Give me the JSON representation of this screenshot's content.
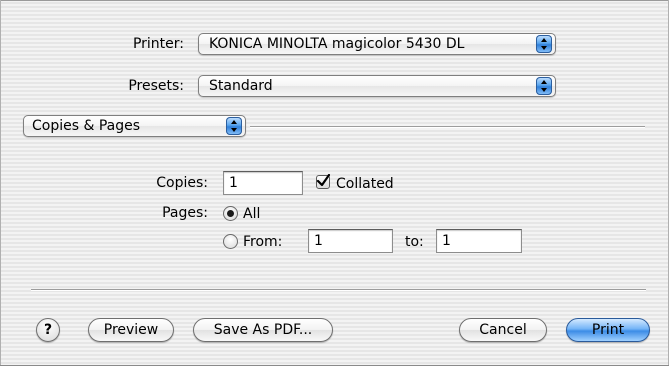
{
  "printer": {
    "label": "Printer:",
    "value": "KONICA MINOLTA magicolor 5430 DL"
  },
  "presets": {
    "label": "Presets:",
    "value": "Standard"
  },
  "section_popup": {
    "value": "Copies & Pages"
  },
  "copies": {
    "label": "Copies:",
    "value": "1",
    "collated_label": "Collated",
    "collated_checked": true
  },
  "pages": {
    "label": "Pages:",
    "all_label": "All",
    "from_label": "From:",
    "from_value": "1",
    "to_label": "to:",
    "to_value": "1",
    "selected": "all"
  },
  "buttons": {
    "help": "?",
    "preview": "Preview",
    "save_pdf": "Save As PDF...",
    "cancel": "Cancel",
    "print": "Print"
  },
  "colors": {
    "accent_blue": "#3c8ce6"
  }
}
